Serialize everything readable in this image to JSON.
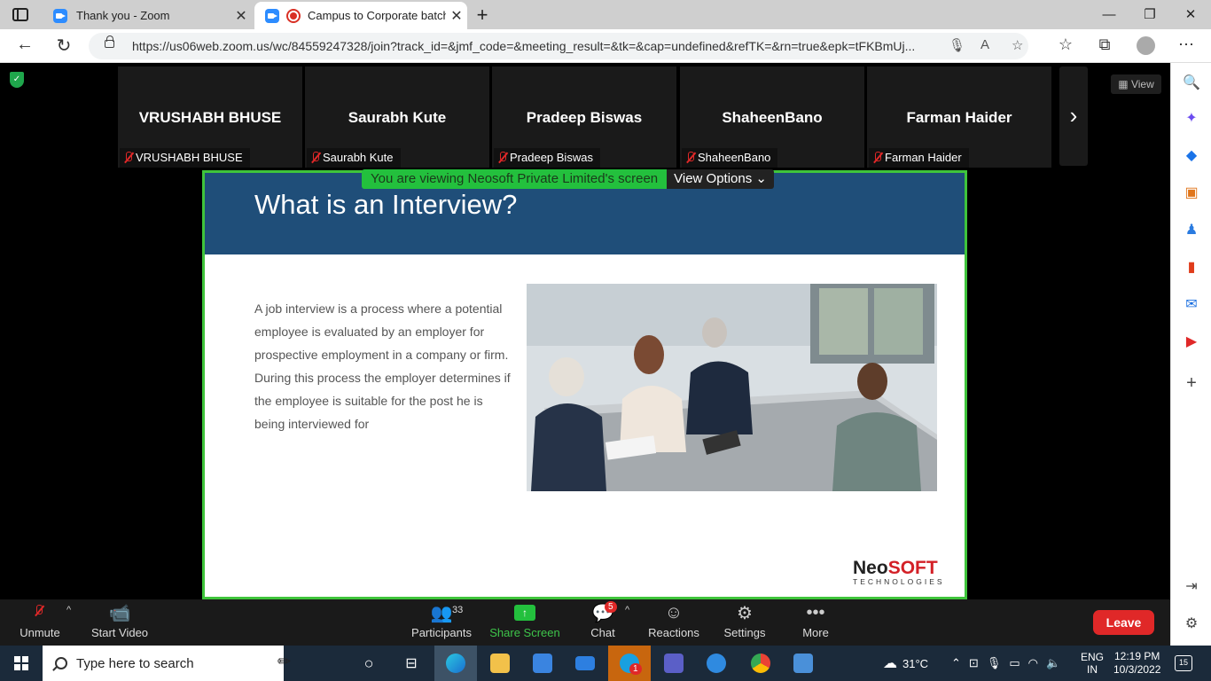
{
  "browser": {
    "tabs": [
      {
        "title": "Thank you - Zoom",
        "active": false
      },
      {
        "title": "Campus to Corporate batch",
        "active": true
      }
    ],
    "url": "https://us06web.zoom.us/wc/84559247328/join?track_id=&jmf_code=&meeting_result=&tk=&cap=undefined&refTK=&rn=true&epk=tFKBmUj..."
  },
  "zoom": {
    "view_label": "View",
    "participants": [
      {
        "display": "VRUSHABH BHUSE",
        "label": "VRUSHABH BHUSE"
      },
      {
        "display": "Saurabh Kute",
        "label": "Saurabh Kute"
      },
      {
        "display": "Pradeep Biswas",
        "label": "Pradeep Biswas"
      },
      {
        "display": "ShaheenBano",
        "label": "ShaheenBano"
      },
      {
        "display": "Farman Haider",
        "label": "Farman Haider"
      }
    ],
    "viewing_banner": "You are viewing Neosoft Private Limited's screen",
    "view_options": "View Options",
    "slide": {
      "title": "What is an Interview?",
      "body": "A job interview is a process where a potential employee is evaluated by an employer for prospective employment in a company or firm. During this process the employer determines if the employee is suitable for the post he is being interviewed for",
      "logo_main": "Neo",
      "logo_accent": "SOFT",
      "logo_sub": "TECHNOLOGIES"
    },
    "controls": {
      "unmute": "Unmute",
      "start_video": "Start Video",
      "participants": "Participants",
      "participants_count": "33",
      "share_screen": "Share Screen",
      "chat": "Chat",
      "chat_badge": "5",
      "reactions": "Reactions",
      "settings": "Settings",
      "more": "More",
      "leave": "Leave"
    }
  },
  "taskbar": {
    "search_placeholder": "Type here to search",
    "weather": "31°C",
    "lang": "ENG",
    "region": "IN",
    "time": "12:19 PM",
    "date": "10/3/2022",
    "notifications": "15",
    "skype_badge": "1"
  }
}
